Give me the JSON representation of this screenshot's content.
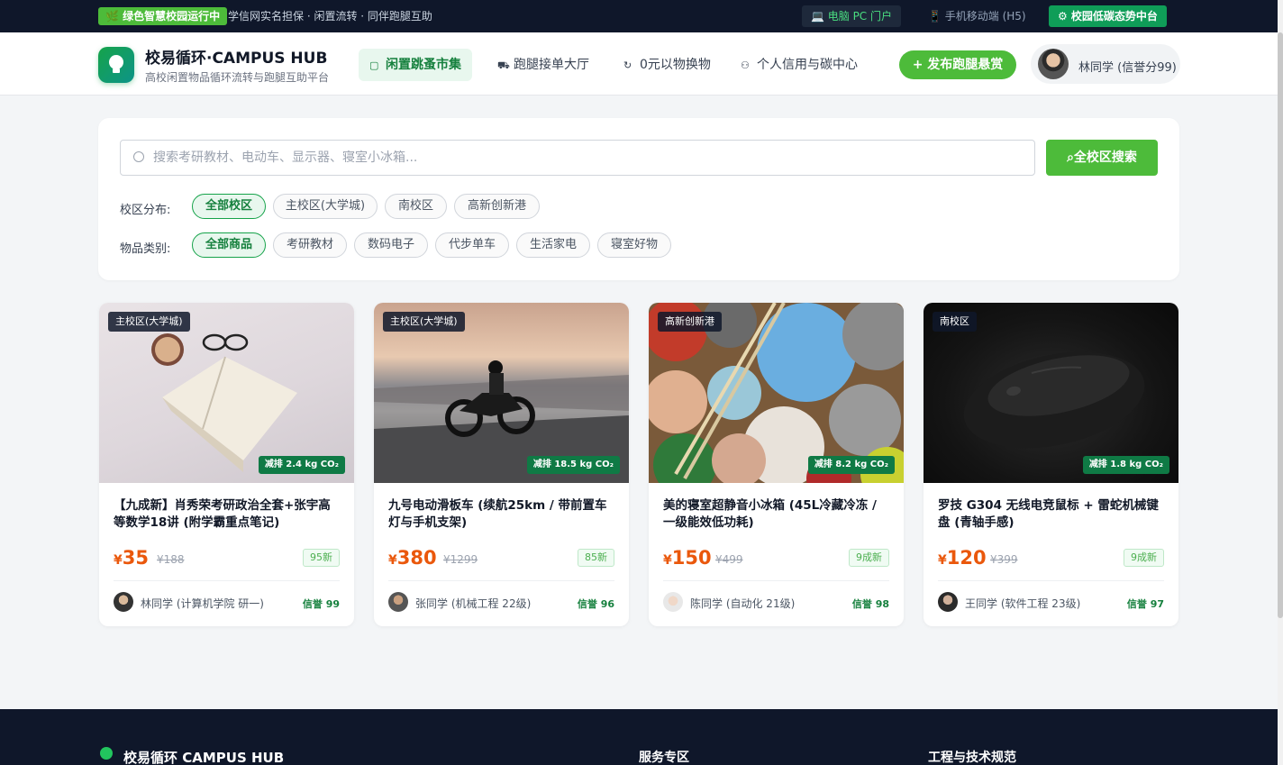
{
  "topbar": {
    "badge": "🌿 绿色智慧校园运行中",
    "tagline": "学信网实名担保 · 闲置流转 · 同伴跑腿互助",
    "pc_portal": "💻 电脑 PC 门户",
    "h5": "📱 手机移动端 (H5)",
    "eco": "⚙ 校园低碳态势中台"
  },
  "header": {
    "title": "校易循环·CAMPUS HUB",
    "subtitle": "高校闲置物品循环流转与跑腿互助平台",
    "nav": [
      {
        "label": "闲置跳蚤市集",
        "icon": "bag-icon"
      },
      {
        "label": "跑腿接单大厅",
        "icon": "truck-icon"
      },
      {
        "label": "0元以物换物",
        "icon": "refresh-icon"
      },
      {
        "label": "个人信用与碳中心",
        "icon": "user-icon"
      }
    ],
    "publish": "+ 发布跑腿悬赏",
    "user": "林同学 (信誉分99)"
  },
  "search": {
    "placeholder": "搜索考研教材、电动车、显示器、寝室小冰箱...",
    "button": "全校区搜索"
  },
  "filters": {
    "campus_label": "校区分布:",
    "campus": [
      "全部校区",
      "主校区(大学城)",
      "南校区",
      "高新创新港"
    ],
    "category_label": "物品类别:",
    "category": [
      "全部商品",
      "考研教材",
      "数码电子",
      "代步单车",
      "生活家电",
      "寝室好物"
    ]
  },
  "items": [
    {
      "campus": "主校区(大学城)",
      "co2": "减排 2.4 kg CO₂",
      "title": "【九成新】肖秀荣考研政治全套+张宇高等数学18讲 (附学霸重点笔记)",
      "yen": "¥",
      "price": "35",
      "orig": "¥188",
      "cond": "95新",
      "seller": "林同学 (计算机学院 研一)",
      "credit": "信誉 99"
    },
    {
      "campus": "主校区(大学城)",
      "co2": "减排 18.5 kg CO₂",
      "title": "九号电动滑板车 (续航25km / 带前置车灯与手机支架)",
      "yen": "¥",
      "price": "380",
      "orig": "¥1299",
      "cond": "85新",
      "seller": "张同学 (机械工程 22级)",
      "credit": "信誉 96"
    },
    {
      "campus": "高新创新港",
      "co2": "减排 8.2 kg CO₂",
      "title": "美的寝室超静音小冰箱 (45L冷藏冷冻 / 一级能效低功耗)",
      "yen": "¥",
      "price": "150",
      "orig": "¥499",
      "cond": "9成新",
      "seller": "陈同学 (自动化 21级)",
      "credit": "信誉 98"
    },
    {
      "campus": "南校区",
      "co2": "减排 1.8 kg CO₂",
      "title": "罗技 G304 无线电竞鼠标 + 雷蛇机械键盘 (青轴手感)",
      "yen": "¥",
      "price": "120",
      "orig": "¥399",
      "cond": "9成新",
      "seller": "王同学 (软件工程 23级)",
      "credit": "信誉 97"
    }
  ],
  "footer": {
    "brand": "校易循环 CAMPUS HUB",
    "col1": "服务专区",
    "col2": "工程与技术规范"
  }
}
